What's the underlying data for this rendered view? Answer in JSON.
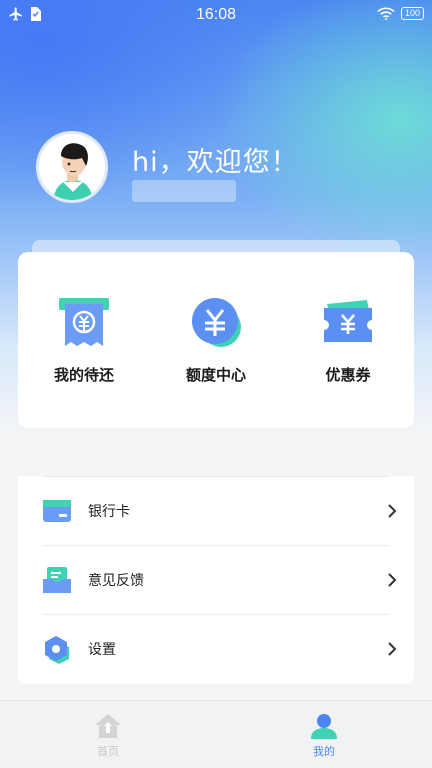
{
  "status_bar": {
    "time": "16:08",
    "battery": "100",
    "icons": [
      "airplane-icon",
      "sim-icon",
      "wifi-icon",
      "battery-icon"
    ]
  },
  "profile": {
    "greeting": "hi，欢迎您！",
    "avatar_icon": "avatar-illustration"
  },
  "quick_actions": [
    {
      "label": "我的待还",
      "icon": "bill-icon"
    },
    {
      "label": "额度中心",
      "icon": "yen-coin-icon"
    },
    {
      "label": "优惠券",
      "icon": "coupon-icon"
    }
  ],
  "menu": [
    {
      "label": "银行卡",
      "icon": "bank-card-icon"
    },
    {
      "label": "意见反馈",
      "icon": "feedback-icon"
    },
    {
      "label": "设置",
      "icon": "settings-icon"
    }
  ],
  "tabs": [
    {
      "label": "首页",
      "icon": "home-icon",
      "active": false
    },
    {
      "label": "我的",
      "icon": "user-icon",
      "active": true
    }
  ],
  "colors": {
    "accent": "#4b86f2",
    "teal": "#3fd3b5",
    "inactive": "#c7c7c7"
  }
}
